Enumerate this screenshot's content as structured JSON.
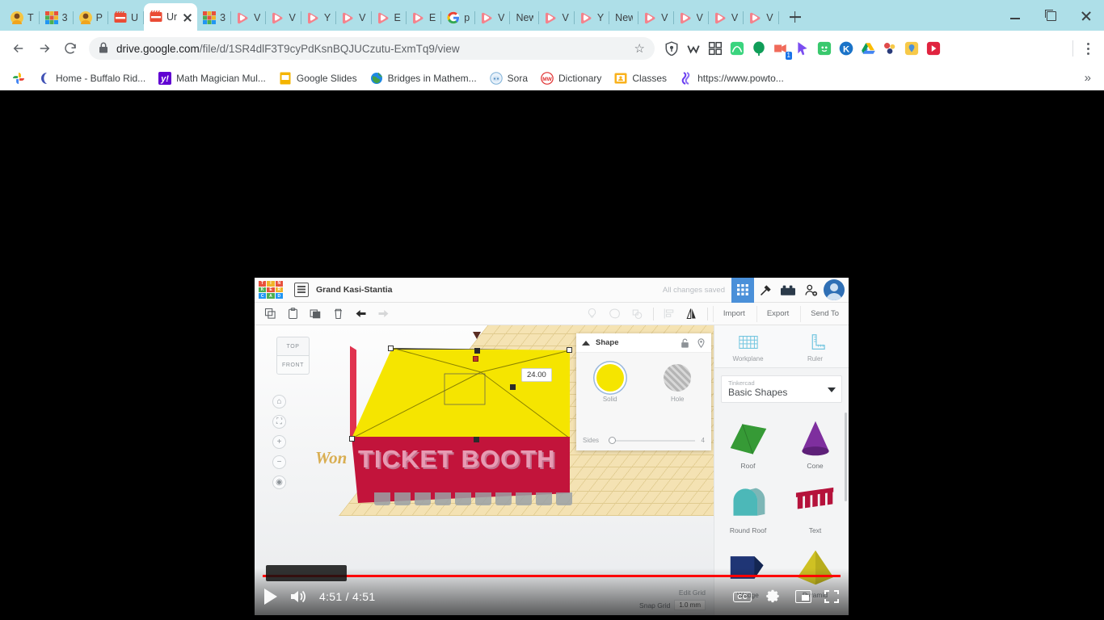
{
  "browser": {
    "tabs": [
      {
        "label": "T",
        "icon": "person-avatar-icon",
        "active": false
      },
      {
        "label": "3",
        "icon": "tinkercad-icon",
        "active": false
      },
      {
        "label": "P",
        "icon": "person-avatar-icon",
        "active": false
      },
      {
        "label": "U",
        "icon": "screencastify-icon",
        "active": false
      },
      {
        "label": "Ur",
        "icon": "screencastify-icon",
        "active": true
      },
      {
        "label": "3",
        "icon": "tinkercad-icon",
        "active": false
      },
      {
        "label": "V",
        "icon": "video-icon",
        "active": false
      },
      {
        "label": "V",
        "icon": "video-icon",
        "active": false
      },
      {
        "label": "Y",
        "icon": "video-icon",
        "active": false
      },
      {
        "label": "V",
        "icon": "video-icon",
        "active": false
      },
      {
        "label": "E",
        "icon": "video-icon",
        "active": false
      },
      {
        "label": "E",
        "icon": "video-icon",
        "active": false
      },
      {
        "label": "p",
        "icon": "google-icon",
        "active": false
      },
      {
        "label": "V",
        "icon": "video-icon",
        "active": false
      },
      {
        "label": "New",
        "icon": "none",
        "active": false
      },
      {
        "label": "V",
        "icon": "video-icon",
        "active": false
      },
      {
        "label": "Y",
        "icon": "video-icon",
        "active": false
      },
      {
        "label": "New",
        "icon": "none",
        "active": false
      },
      {
        "label": "V",
        "icon": "video-icon",
        "active": false
      },
      {
        "label": "V",
        "icon": "video-icon",
        "active": false
      },
      {
        "label": "V",
        "icon": "video-icon",
        "active": false
      },
      {
        "label": "V",
        "icon": "video-icon",
        "active": false
      }
    ],
    "omnibox": {
      "domain": "drive.google.com",
      "path": "/file/d/1SR4dlF3T9cyPdKsnBQJUCzutu-ExmTq9/view",
      "lock_icon": "lock-icon",
      "star_icon": "bookmark-star-icon"
    },
    "extensions": [
      {
        "name": "shield-extension-icon",
        "badge": ""
      },
      {
        "name": "grammar-extension-icon",
        "badge": ""
      },
      {
        "name": "apps-grid-icon",
        "badge": ""
      },
      {
        "name": "desmos-extension-icon",
        "badge": ""
      },
      {
        "name": "green-balloon-extension-icon",
        "badge": ""
      },
      {
        "name": "screencastify-extension-icon",
        "badge": "1"
      },
      {
        "name": "cursor-extension-icon",
        "badge": ""
      },
      {
        "name": "classdojo-extension-icon",
        "badge": ""
      },
      {
        "name": "kami-extension-icon",
        "badge": ""
      },
      {
        "name": "google-drive-extension-icon",
        "badge": ""
      },
      {
        "name": "molecule-extension-icon",
        "badge": ""
      },
      {
        "name": "yellow-pin-extension-icon",
        "badge": ""
      },
      {
        "name": "red-play-extension-icon",
        "badge": ""
      }
    ],
    "bookmarks": [
      {
        "label": "",
        "icon": "photos-icon"
      },
      {
        "label": "Home - Buffalo Rid...",
        "icon": "moon-icon"
      },
      {
        "label": "Math Magician Mul...",
        "icon": "yahoo-icon"
      },
      {
        "label": "Google Slides",
        "icon": "slides-icon"
      },
      {
        "label": "Bridges in Mathem...",
        "icon": "globe-icon"
      },
      {
        "label": "Sora",
        "icon": "sora-icon"
      },
      {
        "label": "Dictionary",
        "icon": "merriam-webster-icon"
      },
      {
        "label": "Classes",
        "icon": "classroom-icon"
      },
      {
        "label": "https://www.powto...",
        "icon": "powtoon-icon"
      }
    ],
    "bookmarks_overflow": "»",
    "window_controls": {
      "minimize": "minimize-icon",
      "maximize": "maximize-icon",
      "close": "close-icon"
    },
    "new_tab_button": "new-tab-icon",
    "nav": {
      "back": "back-arrow-icon",
      "forward": "forward-arrow-icon",
      "reload": "reload-icon",
      "menu": "three-dot-menu-icon"
    }
  },
  "video": {
    "current_time": "4:51",
    "duration": "4:51",
    "time_display": "4:51 / 4:51",
    "progress_percent": 100,
    "play_button_label": "play-button",
    "volume_button_label": "volume-icon",
    "captions_label": "CC",
    "settings_label": "settings-gear-icon",
    "miniplayer_label": "miniplayer-icon",
    "fullscreen_label": "fullscreen-icon"
  },
  "tinkercad": {
    "logo_letters": [
      "T",
      "I",
      "N",
      "K",
      "E",
      "R",
      "C",
      "A",
      "D"
    ],
    "design_name": "Grand Kasi-Stantia",
    "save_status": "All changes saved",
    "top_icons": [
      "grid-view-icon",
      "tools-icon",
      "blocks-icon",
      "add-person-icon",
      "user-avatar-icon"
    ],
    "toolbar_icons": [
      "copy-icon",
      "paste-icon",
      "duplicate-icon",
      "delete-icon",
      "undo-icon",
      "redo-icon"
    ],
    "toolbar_icons_right": [
      "light-icon",
      "group-icon",
      "ungroup-icon",
      "align-icon",
      "mirror-icon"
    ],
    "toolbar_buttons": [
      "Import",
      "Export",
      "Send To"
    ],
    "viewcube": {
      "top": "TOP",
      "front": "FRONT"
    },
    "nav_buttons": [
      "home-view-icon",
      "fit-view-icon",
      "zoom-in-icon",
      "zoom-out-icon",
      "orbit-icon"
    ],
    "canvas": {
      "watermark": "Won",
      "booth_text": "TICKET BOOTH",
      "dimension_label": "24.00",
      "edit_grid": "Edit Grid",
      "snap_grid_label": "Snap Grid",
      "snap_grid_value": "1.0 mm"
    },
    "shape_panel": {
      "title": "Shape",
      "lock_icon": "lock-icon",
      "pin_icon": "pin-icon",
      "options": [
        {
          "label": "Solid",
          "color": "#f5e500",
          "selected": true
        },
        {
          "label": "Hole",
          "color": "#c0c0c0",
          "selected": false
        }
      ],
      "sides_label": "Sides",
      "sides_value": "4"
    },
    "library": {
      "tools": [
        {
          "label": "Workplane",
          "icon": "workplane-icon"
        },
        {
          "label": "Ruler",
          "icon": "ruler-icon"
        }
      ],
      "select_eyebrow": "Tinkercad",
      "select_value": "Basic Shapes",
      "shapes": [
        {
          "label": "Roof",
          "color": "#3fae3f"
        },
        {
          "label": "Cone",
          "color": "#7e2f9e"
        },
        {
          "label": "Round Roof",
          "color": "#4cb8b8"
        },
        {
          "label": "Text",
          "color": "#b5123b"
        },
        {
          "label": "Wedge",
          "color": "#1f3575"
        },
        {
          "label": "Pyramid",
          "color": "#cfc123"
        }
      ]
    }
  }
}
